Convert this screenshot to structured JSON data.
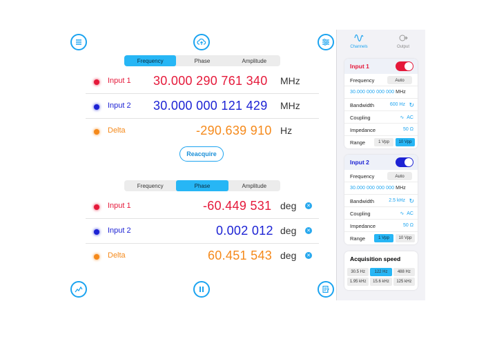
{
  "top_tabs": [
    "Frequency",
    "Phase",
    "Amplitude"
  ],
  "frequency_rows": [
    {
      "label": "Input 1",
      "value": "30.000 290 761 340",
      "unit": "MHz"
    },
    {
      "label": "Input 2",
      "value": "30.000 000 121 429",
      "unit": "MHz"
    },
    {
      "label": "Delta",
      "value": "-290.639 910",
      "unit": "Hz"
    }
  ],
  "reacquire_label": "Reacquire",
  "phase_tabs": [
    "Frequency",
    "Phase",
    "Amplitude"
  ],
  "phase_rows": [
    {
      "label": "Input 1",
      "value": "-60.449 531",
      "unit": "deg"
    },
    {
      "label": "Input 2",
      "value": "0.002 012",
      "unit": "deg"
    },
    {
      "label": "Delta",
      "value": "60.451 543",
      "unit": "deg"
    }
  ],
  "sidebar": {
    "tabs": [
      "Channels",
      "Output"
    ],
    "input1": {
      "title": "Input 1",
      "frequency_label": "Frequency",
      "frequency_mode": "Auto",
      "frequency_value": "30.000 000 000 000",
      "frequency_unit": "MHz",
      "bandwidth_label": "Bandwidth",
      "bandwidth_value": "600 Hz",
      "coupling_label": "Coupling",
      "coupling_value": "AC",
      "impedance_label": "Impedance",
      "impedance_value": "50 Ω",
      "range_label": "Range",
      "range_options": [
        "1 Vpp",
        "10 Vpp"
      ]
    },
    "input2": {
      "title": "Input 2",
      "frequency_label": "Frequency",
      "frequency_mode": "Auto",
      "frequency_value": "30.000 000 000 000",
      "frequency_unit": "MHz",
      "bandwidth_label": "Bandwidth",
      "bandwidth_value": "2.5 kHz",
      "coupling_label": "Coupling",
      "coupling_value": "AC",
      "impedance_label": "Impedance",
      "impedance_value": "50 Ω",
      "range_label": "Range",
      "range_options": [
        "1 Vpp",
        "10 Vpp"
      ]
    },
    "acquisition": {
      "title": "Acquisition speed",
      "options": [
        "30.5 Hz",
        "122 Hz",
        "488 Hz",
        "1.95 kHz",
        "15.6 kHz",
        "125 kHz"
      ]
    }
  },
  "colors": {
    "accent": "#1aa3f0",
    "input1": "#e5193a",
    "input2": "#1c22d4",
    "delta": "#f5891a",
    "active": "#27b6f5"
  },
  "icons": [
    "menu-icon",
    "cloud-upload-icon",
    "sliders-icon",
    "chart-icon",
    "pause-icon",
    "notes-icon",
    "wave-icon",
    "output-icon",
    "refresh-icon"
  ]
}
